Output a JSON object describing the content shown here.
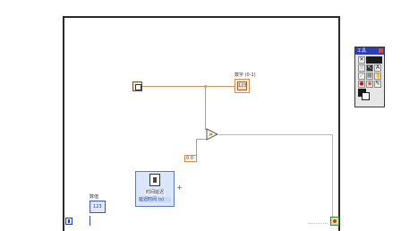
{
  "block_diagram": {
    "numeric_indicator_label": "数字 (0-1)",
    "numeric_indicator_value": "123",
    "numeric_control_label": "数值",
    "numeric_control_value": "123",
    "timer_label": "时间延迟",
    "timer_sublabel": "延迟时间 (s)",
    "small_constant_value": "0.0"
  },
  "tools_palette": {
    "title": "工具",
    "tools": [
      "auto-select",
      "operate",
      "position",
      "label",
      "wire",
      "object-shortcut",
      "scroll",
      "breakpoint",
      "probe",
      "color-copy",
      "color"
    ]
  },
  "colors": {
    "wire_orange": "#d8935a",
    "wire_gray": "#b9b9b9",
    "palette_blue": "#2b3fb8"
  }
}
